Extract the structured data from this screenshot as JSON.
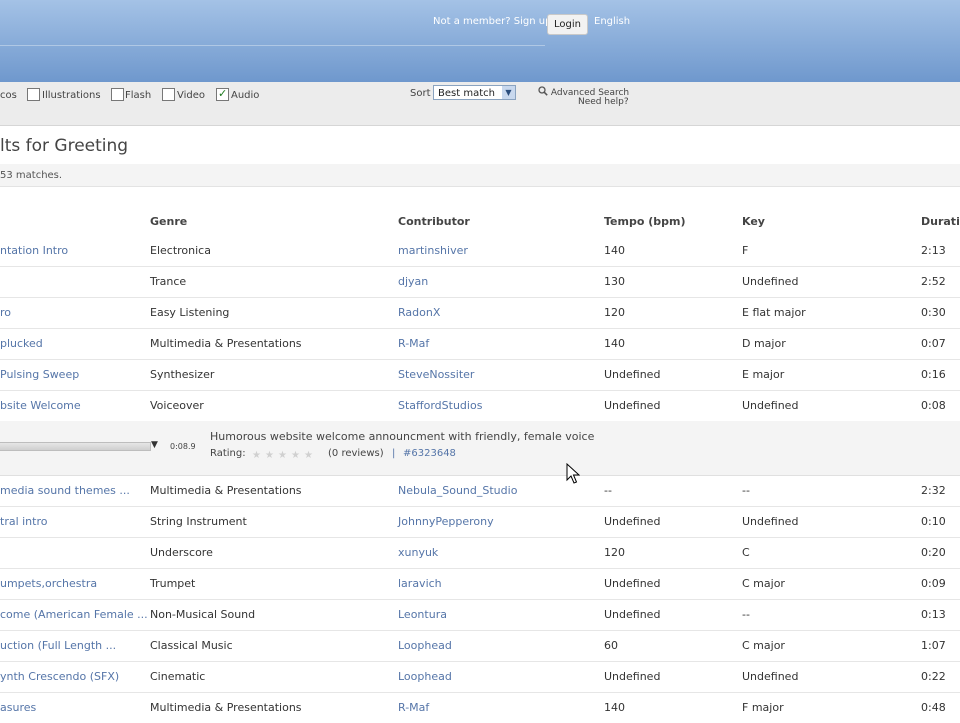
{
  "header": {
    "not_member": "Not a member? Sign up",
    "login": "Login",
    "language": "English"
  },
  "filters": {
    "partial_label": "cos",
    "types": [
      {
        "label": "Illustrations",
        "checked": false
      },
      {
        "label": "Flash",
        "checked": false
      },
      {
        "label": "Video",
        "checked": false
      },
      {
        "label": "Audio",
        "checked": true
      }
    ],
    "sort_label": "Sort",
    "sort_value": "Best match",
    "advanced_search": "Advanced Search",
    "need_help": "Need help?"
  },
  "results": {
    "title": "lts for Greeting",
    "matches": "53 matches."
  },
  "columns": [
    "Genre",
    "Contributor",
    "Tempo (bpm)",
    "Key",
    "Duratio"
  ],
  "rows": [
    {
      "title": "ntation Intro",
      "genre": "Electronica",
      "contributor": "martinshiver",
      "tempo": "140",
      "key": "F",
      "duration": "2:13"
    },
    {
      "title": "",
      "genre": "Trance",
      "contributor": "djyan",
      "tempo": "130",
      "key": "Undefined",
      "duration": "2:52"
    },
    {
      "title": "ro",
      "genre": "Easy Listening",
      "contributor": "RadonX",
      "tempo": "120",
      "key": "E flat major",
      "duration": "0:30"
    },
    {
      "title": "plucked",
      "genre": "Multimedia & Presentations",
      "contributor": "R-Maf",
      "tempo": "140",
      "key": "D major",
      "duration": "0:07"
    },
    {
      "title": "Pulsing Sweep",
      "genre": "Synthesizer",
      "contributor": "SteveNossiter",
      "tempo": "Undefined",
      "key": "E major",
      "duration": "0:16"
    },
    {
      "title": "bsite Welcome",
      "genre": "Voiceover",
      "contributor": "StaffordStudios",
      "tempo": "Undefined",
      "key": "Undefined",
      "duration": "0:08"
    },
    {
      "title": "media sound themes ...",
      "genre": "Multimedia & Presentations",
      "contributor": "Nebula_Sound_Studio",
      "tempo": "--",
      "key": "--",
      "duration": "2:32"
    },
    {
      "title": "tral intro",
      "genre": "String Instrument",
      "contributor": "JohnnyPepperony",
      "tempo": "Undefined",
      "key": "Undefined",
      "duration": "0:10"
    },
    {
      "title": "",
      "genre": "Underscore",
      "contributor": "xunyuk",
      "tempo": "120",
      "key": "C",
      "duration": "0:20"
    },
    {
      "title": "umpets,orchestra",
      "genre": "Trumpet",
      "contributor": "laravich",
      "tempo": "Undefined",
      "key": "C major",
      "duration": "0:09"
    },
    {
      "title": "come (American Female ...",
      "genre": "Non-Musical Sound",
      "contributor": "Leontura",
      "tempo": "Undefined",
      "key": "--",
      "duration": "0:13"
    },
    {
      "title": "uction (Full Length ...",
      "genre": "Classical Music",
      "contributor": "Loophead",
      "tempo": "60",
      "key": "C major",
      "duration": "1:07"
    },
    {
      "title": "ynth Crescendo (SFX)",
      "genre": "Cinematic",
      "contributor": "Loophead",
      "tempo": "Undefined",
      "key": "Undefined",
      "duration": "0:22"
    },
    {
      "title": "asures",
      "genre": "Multimedia & Presentations",
      "contributor": "R-Maf",
      "tempo": "140",
      "key": "F major",
      "duration": "0:48"
    }
  ],
  "expanded": {
    "time": "0:08.9",
    "description": "Humorous website welcome announcment with friendly, female voice",
    "rating_label": "Rating:",
    "rating_value": 0,
    "reviews": "(0 reviews)",
    "separator": "|",
    "id": "#6323648"
  }
}
